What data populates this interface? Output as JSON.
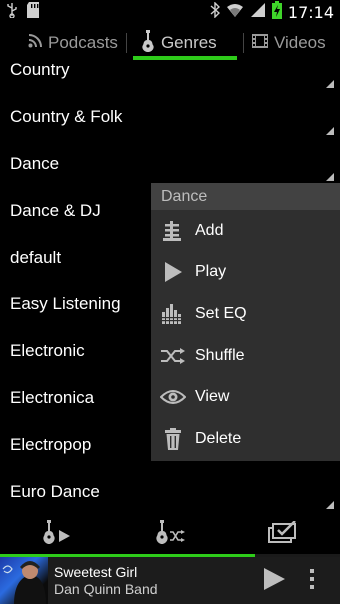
{
  "status_bar": {
    "time": "17:14"
  },
  "tabs": [
    {
      "label": "Podcasts",
      "icon": "rss-icon",
      "active": false
    },
    {
      "label": "Genres",
      "icon": "guitar-icon",
      "active": true
    },
    {
      "label": "Videos",
      "icon": "film-icon",
      "active": false
    }
  ],
  "genres": [
    {
      "label": "Country"
    },
    {
      "label": "Country & Folk"
    },
    {
      "label": "Dance"
    },
    {
      "label": "Dance & DJ"
    },
    {
      "label": "default"
    },
    {
      "label": "Easy Listening"
    },
    {
      "label": "Electronic"
    },
    {
      "label": "Electronica"
    },
    {
      "label": "Electropop"
    },
    {
      "label": "Euro Dance"
    }
  ],
  "context_menu": {
    "title": "Dance",
    "items": [
      {
        "label": "Add",
        "icon": "add-to-queue-icon"
      },
      {
        "label": "Play",
        "icon": "play-icon"
      },
      {
        "label": "Set EQ",
        "icon": "equalizer-icon"
      },
      {
        "label": "Shuffle",
        "icon": "shuffle-icon"
      },
      {
        "label": "View",
        "icon": "eye-icon"
      },
      {
        "label": "Delete",
        "icon": "trash-icon"
      }
    ]
  },
  "now_playing": {
    "title": "Sweetest Girl",
    "artist": "Dan Quinn Band",
    "progress": 0.75
  },
  "colors": {
    "accent": "#2ecc1a"
  }
}
